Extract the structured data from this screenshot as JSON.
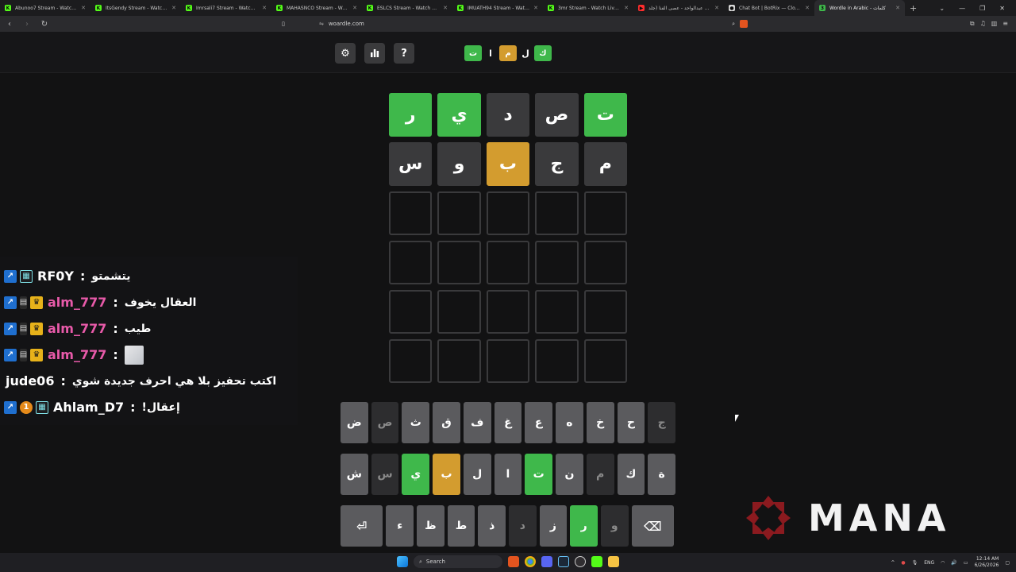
{
  "browser": {
    "tabs": [
      {
        "label": "Abunoo7 Stream - Watch Live",
        "color": "#53fc18",
        "glyph": "K"
      },
      {
        "label": "ItsGendy Stream - Watch Live",
        "color": "#53fc18",
        "glyph": "K"
      },
      {
        "label": "Imrsali7 Stream - Watch Live",
        "color": "#53fc18",
        "glyph": "K"
      },
      {
        "label": "MAHASNCO Stream - Watch Live",
        "color": "#53fc18",
        "glyph": "K"
      },
      {
        "label": "ESLCS Stream - Watch Live on",
        "color": "#53fc18",
        "glyph": "K"
      },
      {
        "label": "IMUATH94 Stream - Watch Live",
        "color": "#53fc18",
        "glyph": "K"
      },
      {
        "label": "3mr Stream - Watch Live on Kick",
        "color": "#53fc18",
        "glyph": "K"
      },
      {
        "label": "فؤاد عبدالواحد - عصى الفنا (جلد...",
        "color": "#ff2d2d",
        "glyph": "▶"
      },
      {
        "label": "Chat Bot | BotRix — Cloud Stream",
        "color": "#d8d8d8",
        "glyph": "●"
      },
      {
        "label": "Wordle in Arabic - كلمات",
        "color": "#3fb84b",
        "glyph": "3",
        "active": true
      }
    ],
    "new_tab": "+",
    "url": "woardle.com"
  },
  "game": {
    "logo_tiles": [
      {
        "letter": "ك",
        "state": "correct"
      },
      {
        "letter": "ل",
        "state": "plain"
      },
      {
        "letter": "م",
        "state": "present"
      },
      {
        "letter": "ا",
        "state": "plain"
      },
      {
        "letter": "ت",
        "state": "correct"
      }
    ],
    "buttons": {
      "settings": "⚙",
      "stats": "▮▮",
      "help": "?"
    },
    "board": [
      [
        {
          "l": "ت",
          "s": "correct"
        },
        {
          "l": "ص",
          "s": "absent"
        },
        {
          "l": "د",
          "s": "absent"
        },
        {
          "l": "ي",
          "s": "correct"
        },
        {
          "l": "ر",
          "s": "correct"
        }
      ],
      [
        {
          "l": "م",
          "s": "absent"
        },
        {
          "l": "ج",
          "s": "absent"
        },
        {
          "l": "ب",
          "s": "present"
        },
        {
          "l": "و",
          "s": "absent"
        },
        {
          "l": "س",
          "s": "absent"
        }
      ],
      [
        {
          "l": "",
          "s": "empty"
        },
        {
          "l": "",
          "s": "empty"
        },
        {
          "l": "",
          "s": "empty"
        },
        {
          "l": "",
          "s": "empty"
        },
        {
          "l": "",
          "s": "empty"
        }
      ],
      [
        {
          "l": "",
          "s": "empty"
        },
        {
          "l": "",
          "s": "empty"
        },
        {
          "l": "",
          "s": "empty"
        },
        {
          "l": "",
          "s": "empty"
        },
        {
          "l": "",
          "s": "empty"
        }
      ],
      [
        {
          "l": "",
          "s": "empty"
        },
        {
          "l": "",
          "s": "empty"
        },
        {
          "l": "",
          "s": "empty"
        },
        {
          "l": "",
          "s": "empty"
        },
        {
          "l": "",
          "s": "empty"
        }
      ],
      [
        {
          "l": "",
          "s": "empty"
        },
        {
          "l": "",
          "s": "empty"
        },
        {
          "l": "",
          "s": "empty"
        },
        {
          "l": "",
          "s": "empty"
        },
        {
          "l": "",
          "s": "empty"
        }
      ]
    ],
    "keyboard": [
      [
        {
          "k": "ج",
          "s": "absent"
        },
        {
          "k": "ح",
          "s": "unused"
        },
        {
          "k": "خ",
          "s": "unused"
        },
        {
          "k": "ه",
          "s": "unused"
        },
        {
          "k": "ع",
          "s": "unused"
        },
        {
          "k": "غ",
          "s": "unused"
        },
        {
          "k": "ف",
          "s": "unused"
        },
        {
          "k": "ق",
          "s": "unused"
        },
        {
          "k": "ث",
          "s": "unused"
        },
        {
          "k": "ص",
          "s": "absent"
        },
        {
          "k": "ض",
          "s": "unused"
        }
      ],
      [
        {
          "k": "ة",
          "s": "unused"
        },
        {
          "k": "ك",
          "s": "unused"
        },
        {
          "k": "م",
          "s": "absent"
        },
        {
          "k": "ن",
          "s": "unused"
        },
        {
          "k": "ت",
          "s": "correct"
        },
        {
          "k": "ا",
          "s": "unused"
        },
        {
          "k": "ل",
          "s": "unused"
        },
        {
          "k": "ب",
          "s": "present"
        },
        {
          "k": "ي",
          "s": "correct"
        },
        {
          "k": "س",
          "s": "absent"
        },
        {
          "k": "ش",
          "s": "unused"
        }
      ],
      [
        {
          "k": "⌫",
          "s": "unused",
          "wide": true
        },
        {
          "k": "و",
          "s": "absent"
        },
        {
          "k": "ر",
          "s": "correct"
        },
        {
          "k": "ز",
          "s": "unused"
        },
        {
          "k": "د",
          "s": "absent"
        },
        {
          "k": "ذ",
          "s": "unused"
        },
        {
          "k": "ط",
          "s": "unused"
        },
        {
          "k": "ظ",
          "s": "unused"
        },
        {
          "k": "ء",
          "s": "unused"
        },
        {
          "k": "⏎",
          "s": "unused",
          "wide": true
        }
      ]
    ]
  },
  "chat": {
    "cut_line": "",
    "messages": [
      {
        "badges": [
          "og",
          "sub"
        ],
        "user": "RF0Y",
        "ucolor": "white",
        "msg": "يتشمتو"
      },
      {
        "badges": [
          "og",
          "gift",
          "crown"
        ],
        "user": "alm_777",
        "ucolor": "pink",
        "msg": "العقال يخوف"
      },
      {
        "badges": [
          "og",
          "gift",
          "crown"
        ],
        "user": "alm_777",
        "ucolor": "pink",
        "msg": "طيب"
      },
      {
        "badges": [
          "og",
          "gift",
          "crown"
        ],
        "user": "alm_777",
        "ucolor": "pink",
        "msg": "",
        "emote": true
      },
      {
        "badges": [],
        "user": "jude06",
        "ucolor": "white",
        "msg": "اكتب تحفيز بلا هي احرف جديدة شوي"
      },
      {
        "badges": [
          "og",
          "one",
          "sub"
        ],
        "user": "Ahlam_D7",
        "ucolor": "white",
        "msg": "!إعقال"
      }
    ],
    "separator": ":"
  },
  "watermark": {
    "word": "MANA",
    "color": "#8b1a1f"
  },
  "taskbar": {
    "search": "Search",
    "lang": "ENG",
    "time": "12:14 AM",
    "date": "6/26/2026"
  },
  "colors": {
    "correct": "#3fb84b",
    "present": "#d39c2f",
    "absent": "#3a3a3c",
    "bg": "#121213"
  }
}
